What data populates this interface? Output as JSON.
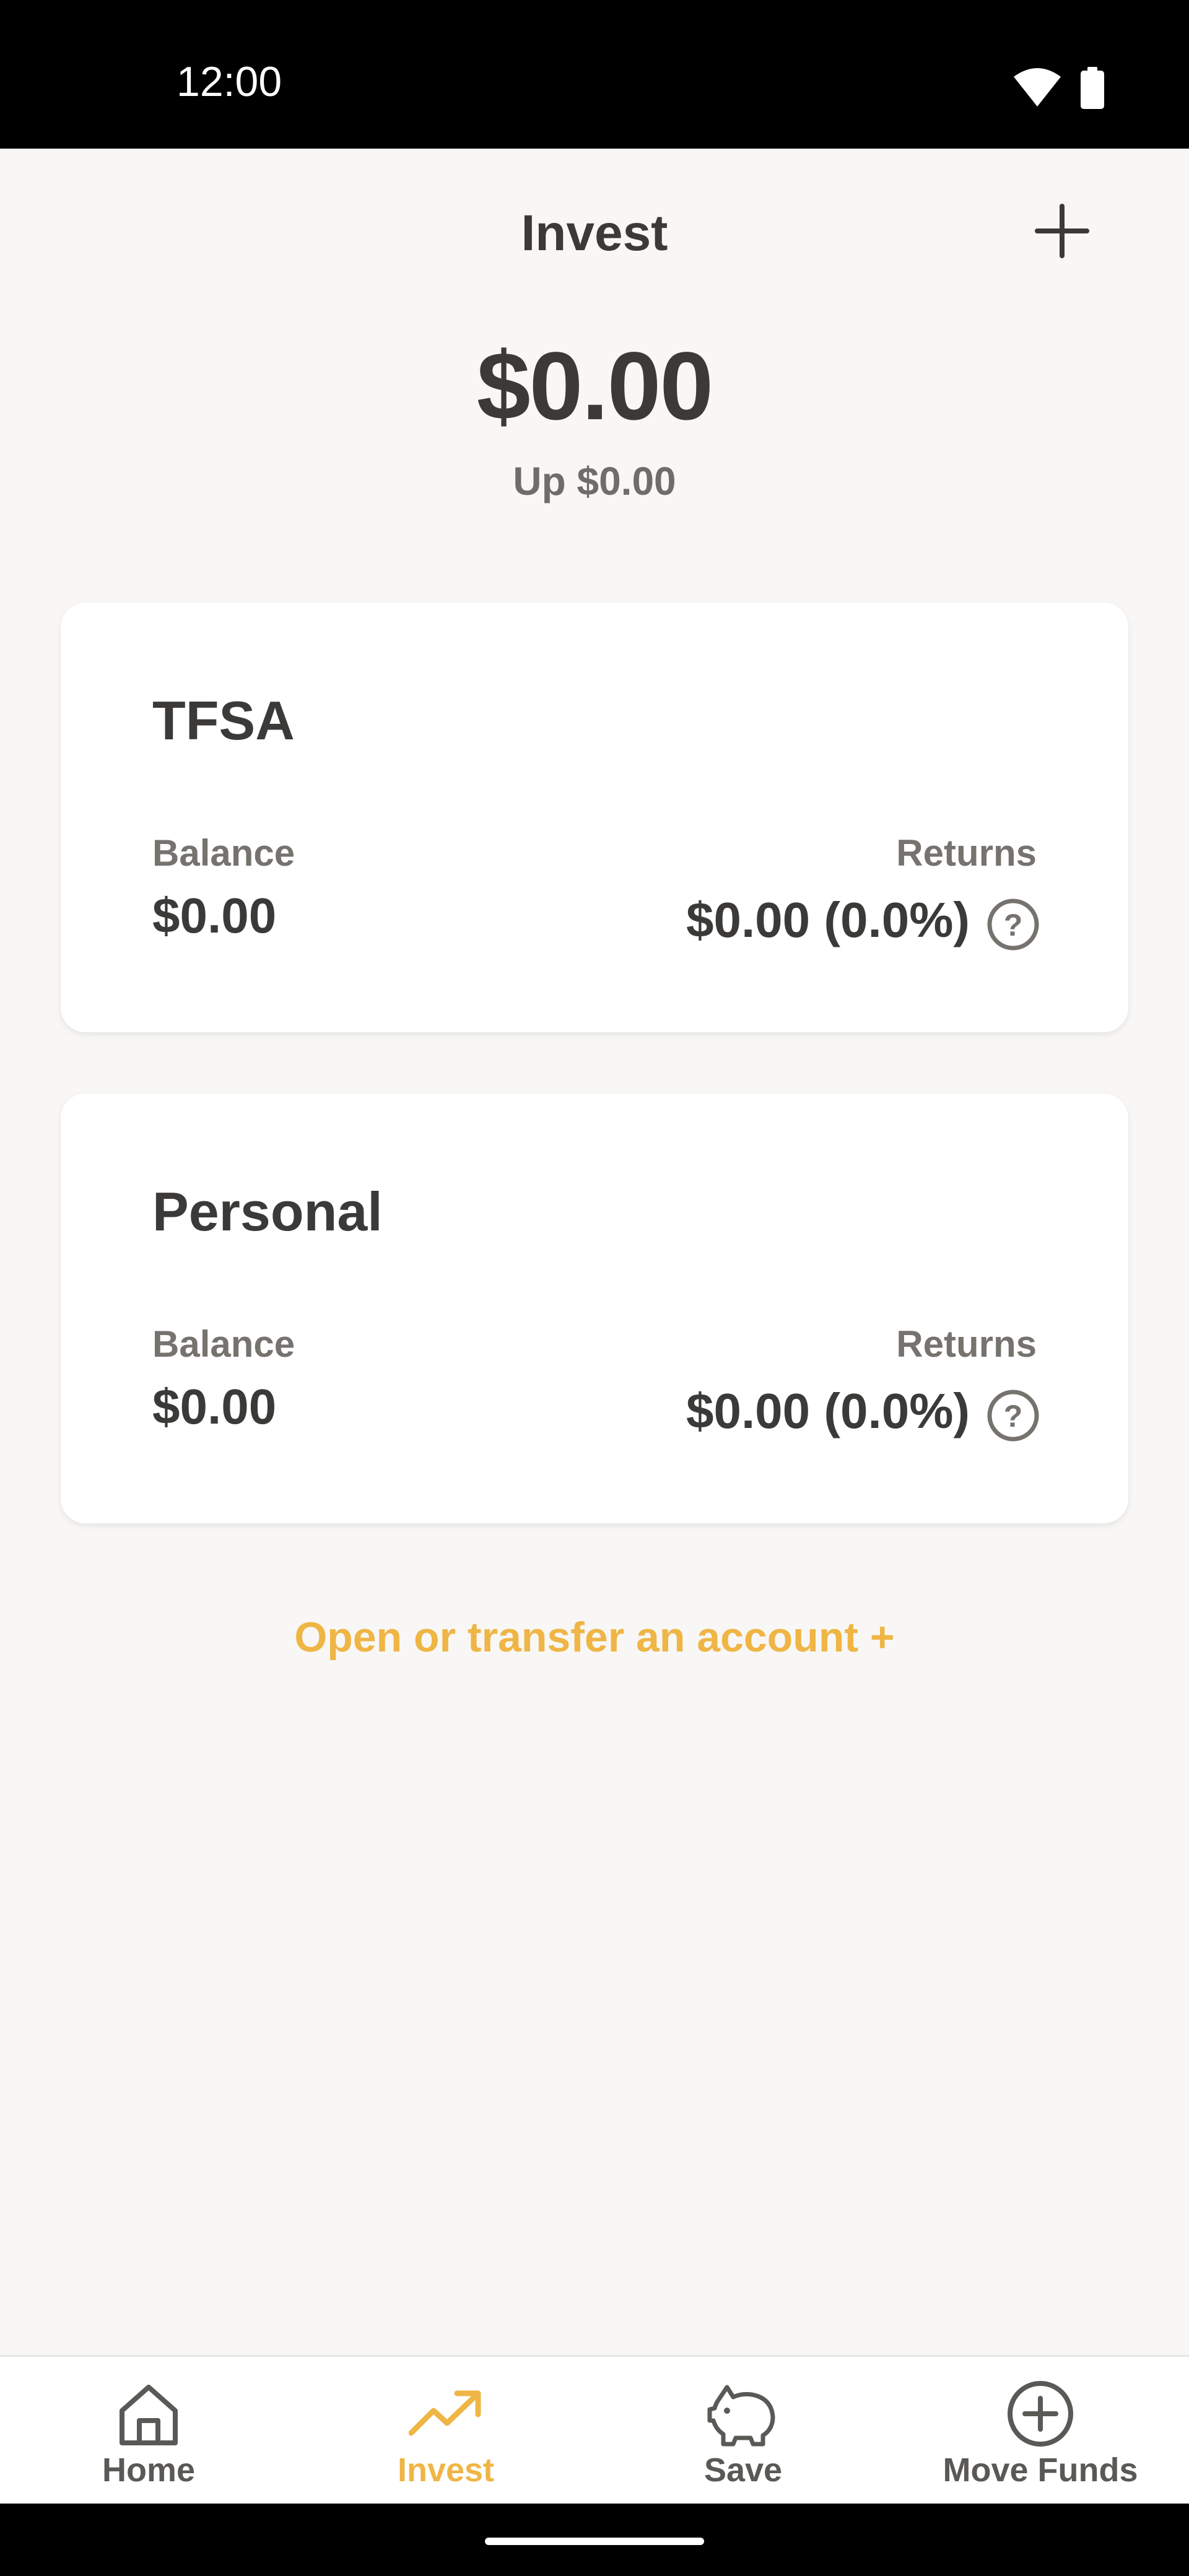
{
  "status_bar": {
    "time": "12:00"
  },
  "header": {
    "title": "Invest"
  },
  "summary": {
    "total": "$0.00",
    "change": "Up $0.00"
  },
  "accounts": [
    {
      "name": "TFSA",
      "balance_label": "Balance",
      "balance": "$0.00",
      "returns_label": "Returns",
      "returns": "$0.00 (0.0%)"
    },
    {
      "name": "Personal",
      "balance_label": "Balance",
      "balance": "$0.00",
      "returns_label": "Returns",
      "returns": "$0.00 (0.0%)"
    }
  ],
  "open_link": "Open or transfer an account +",
  "nav": {
    "items": [
      {
        "label": "Home",
        "icon": "home-icon"
      },
      {
        "label": "Invest",
        "icon": "trending-up-icon",
        "active": true
      },
      {
        "label": "Save",
        "icon": "piggy-bank-icon"
      },
      {
        "label": "Move Funds",
        "icon": "add-circle-icon"
      }
    ]
  },
  "colors": {
    "accent": "#efb545",
    "text": "#3b3a38",
    "muted": "#76736f",
    "background": "#f8f7f5"
  }
}
